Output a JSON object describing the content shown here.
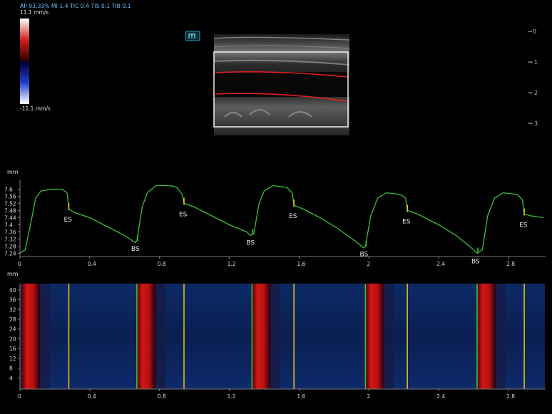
{
  "header": {
    "params": "AP 93.33%  MI 1.4 TIC 0.4 TIS 0.1 TIB 0.1",
    "velocity_max": "11.1 mm/s",
    "velocity_min": "-11.1 mm/s"
  },
  "mode_badge_icon": "m-mode-icon",
  "depth_scale": [
    "0",
    "1",
    "2",
    "3"
  ],
  "waveform": {
    "unit": "mm",
    "y_ticks": [
      "7.6",
      "7.56",
      "7.52",
      "7.48",
      "7.44",
      "7.4",
      "7.36",
      "7.32",
      "7.28",
      "7.24"
    ],
    "x_ticks": [
      "0",
      "0.4",
      "0.8",
      "1.2",
      "1.6",
      "2",
      "2.4",
      "2.8"
    ],
    "es_label": "ES",
    "bs_label": "BS",
    "trace_color": "#3cc03c",
    "marker_color": "#e8c800"
  },
  "tvi": {
    "unit": "mm",
    "y_ticks": [
      "40",
      "36",
      "32",
      "28",
      "24",
      "20",
      "16",
      "12",
      "8",
      "4"
    ],
    "x_ticks": [
      "0",
      "0.4",
      "0.8",
      "1.2",
      "1.6",
      "2",
      "2.4",
      "2.8"
    ]
  },
  "chart_data": {
    "type": "line",
    "x_unit": "s",
    "ylabel": "mm",
    "ylim": [
      7.23,
      7.63
    ],
    "xlim": [
      0,
      3.0
    ],
    "points": [
      [
        0,
        7.24
      ],
      [
        0.03,
        7.26
      ],
      [
        0.06,
        7.4
      ],
      [
        0.09,
        7.55
      ],
      [
        0.12,
        7.59
      ],
      [
        0.18,
        7.6
      ],
      [
        0.24,
        7.6
      ],
      [
        0.27,
        7.58
      ],
      [
        0.28,
        7.49
      ],
      [
        0.31,
        7.47
      ],
      [
        0.4,
        7.44
      ],
      [
        0.5,
        7.39
      ],
      [
        0.6,
        7.34
      ],
      [
        0.66,
        7.3
      ],
      [
        0.67,
        7.31
      ],
      [
        0.7,
        7.5
      ],
      [
        0.73,
        7.58
      ],
      [
        0.78,
        7.62
      ],
      [
        0.86,
        7.62
      ],
      [
        0.9,
        7.61
      ],
      [
        0.93,
        7.57
      ],
      [
        0.94,
        7.52
      ],
      [
        1.0,
        7.5
      ],
      [
        1.1,
        7.45
      ],
      [
        1.2,
        7.4
      ],
      [
        1.3,
        7.36
      ],
      [
        1.32,
        7.34
      ],
      [
        1.34,
        7.35
      ],
      [
        1.37,
        7.52
      ],
      [
        1.4,
        7.59
      ],
      [
        1.45,
        7.62
      ],
      [
        1.53,
        7.61
      ],
      [
        1.56,
        7.58
      ],
      [
        1.57,
        7.51
      ],
      [
        1.62,
        7.49
      ],
      [
        1.72,
        7.44
      ],
      [
        1.82,
        7.38
      ],
      [
        1.92,
        7.31
      ],
      [
        1.97,
        7.27
      ],
      [
        1.98,
        7.28
      ],
      [
        2.01,
        7.45
      ],
      [
        2.05,
        7.55
      ],
      [
        2.1,
        7.58
      ],
      [
        2.18,
        7.57
      ],
      [
        2.21,
        7.55
      ],
      [
        2.22,
        7.48
      ],
      [
        2.28,
        7.46
      ],
      [
        2.4,
        7.4
      ],
      [
        2.5,
        7.34
      ],
      [
        2.6,
        7.26
      ],
      [
        2.62,
        7.24
      ],
      [
        2.65,
        7.26
      ],
      [
        2.68,
        7.45
      ],
      [
        2.72,
        7.55
      ],
      [
        2.77,
        7.58
      ],
      [
        2.85,
        7.57
      ],
      [
        2.88,
        7.54
      ],
      [
        2.89,
        7.46
      ],
      [
        2.93,
        7.45
      ],
      [
        3.0,
        7.44
      ]
    ],
    "es_markers": [
      0.28,
      0.94,
      1.57,
      2.22,
      2.89
    ],
    "bs_markers": [
      0.67,
      1.33,
      1.98,
      2.62
    ]
  }
}
